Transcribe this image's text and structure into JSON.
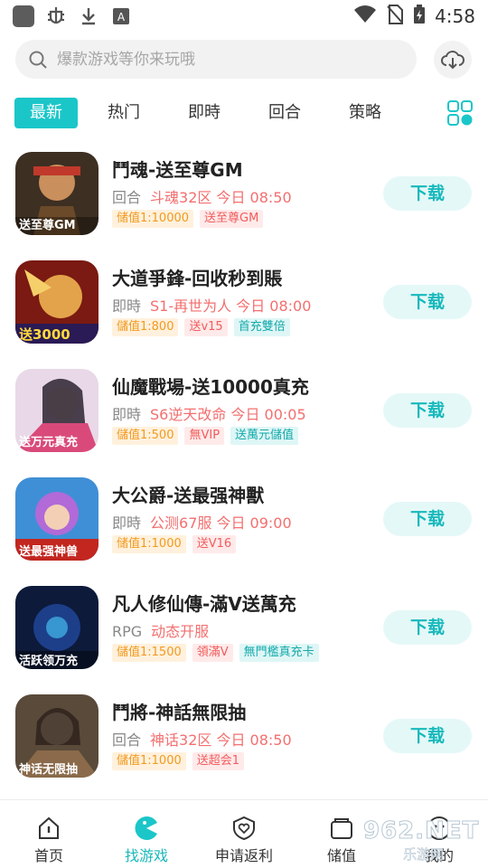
{
  "status_bar": {
    "time": "4:58"
  },
  "search": {
    "placeholder": "爆款游戏等你来玩哦"
  },
  "tabs": [
    {
      "label": "最新",
      "active": true
    },
    {
      "label": "热门"
    },
    {
      "label": "即時"
    },
    {
      "label": "回合"
    },
    {
      "label": "策略"
    }
  ],
  "games": [
    {
      "title": "鬥魂-送至尊GM",
      "type": "回合",
      "server": "斗魂32区 今日 08:50",
      "download": "下载",
      "tags": [
        {
          "text": "储值1:10000",
          "color": "orange"
        },
        {
          "text": "送至尊GM",
          "color": "red"
        }
      ],
      "icon_caption": "送至尊GM"
    },
    {
      "title": "大道爭鋒-回收秒到賬",
      "type": "即時",
      "server": "S1-再世为人 今日 08:00",
      "download": "下载",
      "tags": [
        {
          "text": "儲值1:800",
          "color": "orange"
        },
        {
          "text": "送v15",
          "color": "red"
        },
        {
          "text": "首充雙倍",
          "color": "teal"
        }
      ],
      "icon_caption": "送3000"
    },
    {
      "title": "仙魔戰場-送10000真充",
      "type": "即時",
      "server": "S6逆天改命 今日 00:05",
      "download": "下载",
      "tags": [
        {
          "text": "儲值1:500",
          "color": "orange"
        },
        {
          "text": "無VIP",
          "color": "red"
        },
        {
          "text": "送萬元儲值",
          "color": "teal"
        }
      ],
      "icon_caption": "送万元真充"
    },
    {
      "title": "大公爵-送最强神獸",
      "type": "即時",
      "server": "公测67服 今日 09:00",
      "download": "下载",
      "tags": [
        {
          "text": "储值1:1000",
          "color": "orange"
        },
        {
          "text": "送V16",
          "color": "red"
        }
      ],
      "icon_caption": "送最强神兽"
    },
    {
      "title": "凡人修仙傳-滿V送萬充",
      "type": "RPG",
      "server": "动态开服",
      "download": "下载",
      "tags": [
        {
          "text": "儲值1:1500",
          "color": "orange"
        },
        {
          "text": "領滿V",
          "color": "red"
        },
        {
          "text": "無門檻真充卡",
          "color": "teal"
        }
      ],
      "icon_caption": "活跃领万充"
    },
    {
      "title": "鬥將-神話無限抽",
      "type": "回合",
      "server": "神话32区 今日 08:50",
      "download": "下载",
      "tags": [
        {
          "text": "儲值1:1000",
          "color": "orange"
        },
        {
          "text": "送超会1",
          "color": "red"
        }
      ],
      "icon_caption": "神话无限抽"
    }
  ],
  "bottom_nav": [
    {
      "label": "首页",
      "icon": "home-icon"
    },
    {
      "label": "找游戏",
      "icon": "pacman-icon",
      "active": true
    },
    {
      "label": "申请返利",
      "icon": "shield-heart-icon"
    },
    {
      "label": "储值",
      "icon": "wallet-icon"
    },
    {
      "label": "我的",
      "icon": "smile-icon"
    }
  ],
  "watermark": {
    "brand": "962.NET",
    "sub": "乐游网"
  },
  "colors": {
    "accent": "#1bc6c9",
    "server": "#f36f6f",
    "download_bg": "#e5f8f8"
  }
}
